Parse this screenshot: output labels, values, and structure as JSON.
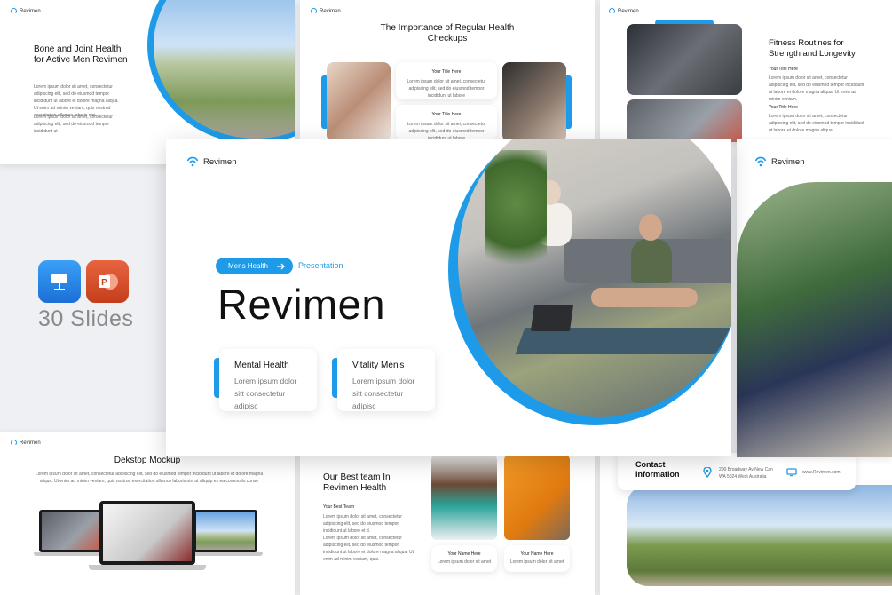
{
  "brand": {
    "name": "Revimen",
    "accent": "#1e9be8"
  },
  "slide_bone": {
    "title": "Bone and Joint Health for Active Men Revimen",
    "para1": "Lorem ipsum dolor sit amet, consectetur adipiscing elit, sed do eiusmod tempor incididunt ut labore et dolore magna aliqua. Ut enim ad minim veniam, quis nostrud exercitation ullamco laboris nisi.",
    "para2": "Lorem ipsum dolor sit amet, consectetur adipiscing elit, sed do eiusmod tempor incididunt ut l"
  },
  "slide_checkups": {
    "title": "The Importance of Regular Health Checkups",
    "card1_title": "Your Title Here",
    "card1_text": "Lorem ipsum dolor sit amet, consectetur adipiscing elit, sed do eiusmod tempor incididunt ut labore",
    "card2_title": "Your Title Here",
    "card2_text": "Lorem ipsum dolor sit amet, consectetur adipiscing elit, sed do eiusmod tempor incididunt ut labore"
  },
  "slide_fitness": {
    "title": "Fitness Routines for Strength and Longevity",
    "item1_title": "Your Title Here",
    "item1_text": "Lorem ipsum dolor sit amet, consectetur adipiscing elit, sed do eiusmod tempor incididunt ut labore et dolore magna aliqua. Ut enim ad minim veniam.",
    "item2_title": "Your Title Here",
    "item2_text": "Lorem ipsum dolor sit amet, consectetur adipiscing elit, sed do eiusmod tempor incididunt ut labore et dolore magna aliqua."
  },
  "promo": {
    "slide_count": "30 Slides"
  },
  "slide_main": {
    "pill_label": "Mens Health",
    "pill_suffix": "Presentation",
    "title": "Revimen",
    "card1_title": "Mental Health",
    "card1_text": "Lorem ipsum dolor sitt consectetur adipisc",
    "card2_title": "Vitality Men's",
    "card2_text": "Lorem ipsum dolor sitt consectetur adipisc"
  },
  "slide_mockup": {
    "title": "Dekstop Mockup",
    "text": "Lorem ipsum dolor sit amet, consectetur adipiscing elit, sed do eiusmod tempor incididunt ut labore et dolore magna aliqua. Ut enim ad minim veniam, quis nostrud exercitation ullamco laboris nisi ut aliquip ex ea commodo conse"
  },
  "slide_team": {
    "title": "Our Best team In Revimen Health",
    "subtitle": "Your Best Team",
    "para1": "Lorem ipsum dolor sit amet, consectetur adipiscing elit, sed do eiusmod tempor incididunt ut labore et d.",
    "para2": "Lorem ipsum dolor sit amet, consectetur adipiscing elit, sed do eiusmod tempor incididunt ut labore et dolore magna aliqua. Ut enim ad minim veniam, quis.",
    "member1_name": "Your Name Here",
    "member1_text": "Lorem ipsum dolor sit amet",
    "member2_name": "Your Name Here",
    "member2_text": "Lorem ipsum dolor sit amet"
  },
  "slide_contact": {
    "title": "Contact Information",
    "address": "200 Broadway Av New Can WA 5024 West Australia",
    "website": "www.Revimen.com"
  }
}
